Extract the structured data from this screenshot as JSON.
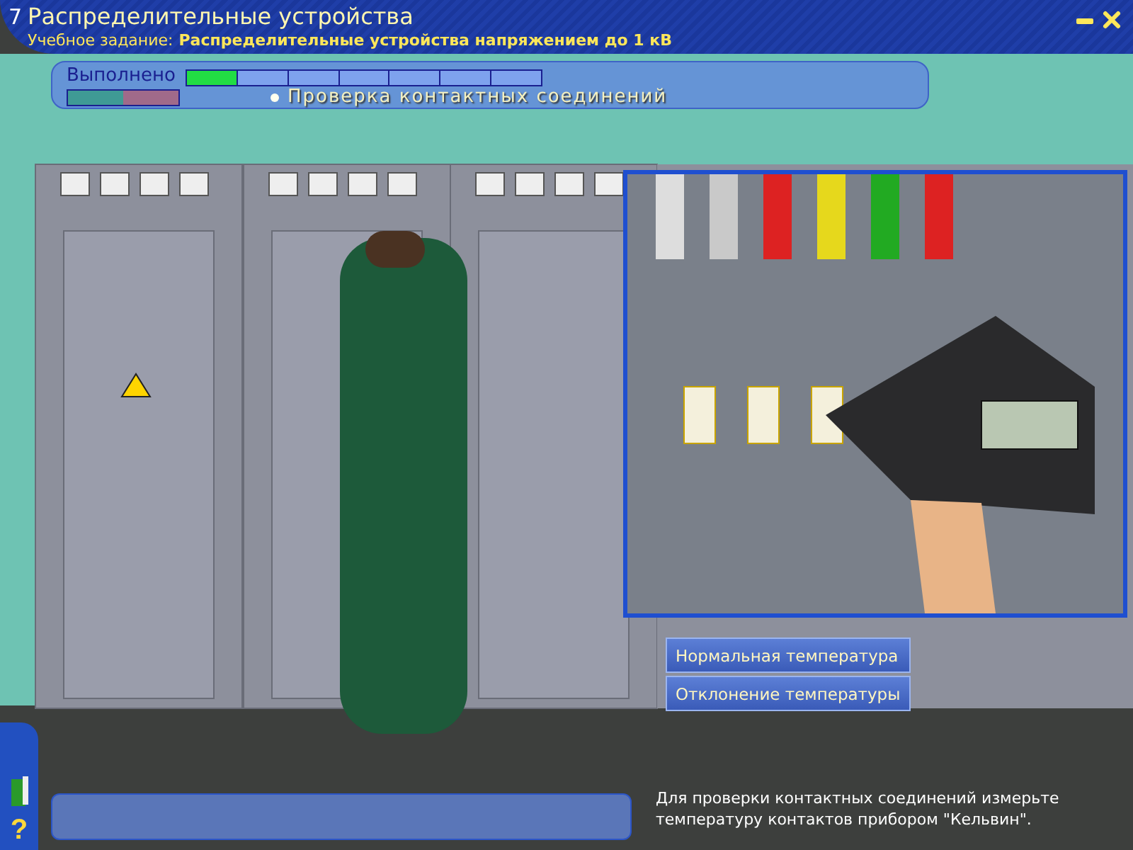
{
  "window": {
    "number": "7",
    "title": "Распределительные устройства"
  },
  "task": {
    "label": "Учебное задание:",
    "value": "Распределительные устройства напряжением до 1 кВ"
  },
  "progress": {
    "label": "Выполнено",
    "level": 0.14,
    "step": "Проверка контактных соединений"
  },
  "answers": [
    {
      "label": "Нормальная температура"
    },
    {
      "label": "Отклонение температуры"
    }
  ],
  "sidebar": {
    "help": "?"
  },
  "hint": "Для проверки контактных соединений измерьте температуру контактов прибором \"Кельвин\"."
}
